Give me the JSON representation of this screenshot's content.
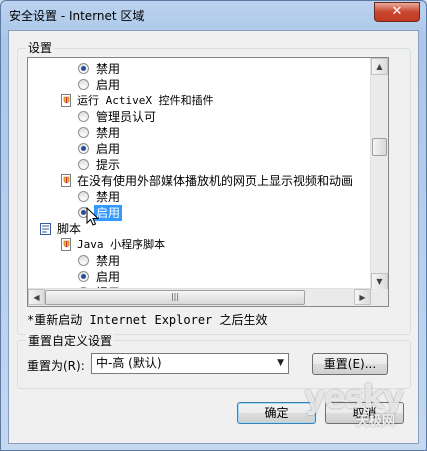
{
  "window": {
    "title": "安全设置 - Internet 区域",
    "close_glyph": "✕"
  },
  "settings_group": {
    "title": "设置"
  },
  "tree_rows": [
    {
      "kind": "radio",
      "label": "禁用",
      "checked": true
    },
    {
      "kind": "radio",
      "label": "启用",
      "checked": false
    },
    {
      "kind": "setting",
      "label": "运行 ActiveX 控件和插件"
    },
    {
      "kind": "radio",
      "label": "管理员认可",
      "checked": false
    },
    {
      "kind": "radio",
      "label": "禁用",
      "checked": false
    },
    {
      "kind": "radio",
      "label": "启用",
      "checked": true
    },
    {
      "kind": "radio",
      "label": "提示",
      "checked": false
    },
    {
      "kind": "setting",
      "label": "在没有使用外部媒体播放机的网页上显示视频和动画"
    },
    {
      "kind": "radio",
      "label": "禁用",
      "checked": false
    },
    {
      "kind": "radio",
      "label": "启用",
      "checked": true,
      "selected": true
    },
    {
      "kind": "category",
      "label": "脚本"
    },
    {
      "kind": "setting",
      "label": "Java 小程序脚本"
    },
    {
      "kind": "radio",
      "label": "禁用",
      "checked": false
    },
    {
      "kind": "radio",
      "label": "启用",
      "checked": true
    },
    {
      "kind": "radio",
      "label": "提示",
      "checked": false
    }
  ],
  "note": "*重新启动 Internet Explorer 之后生效",
  "reset_group": {
    "title": "重置自定义设置",
    "label": "重置为(R):",
    "selected_value": "中-高 (默认)",
    "reset_button": "重置(E)..."
  },
  "footer": {
    "ok": "确定",
    "cancel": "取消"
  },
  "watermark": {
    "line1": "yesky",
    "line2": "天极网"
  }
}
